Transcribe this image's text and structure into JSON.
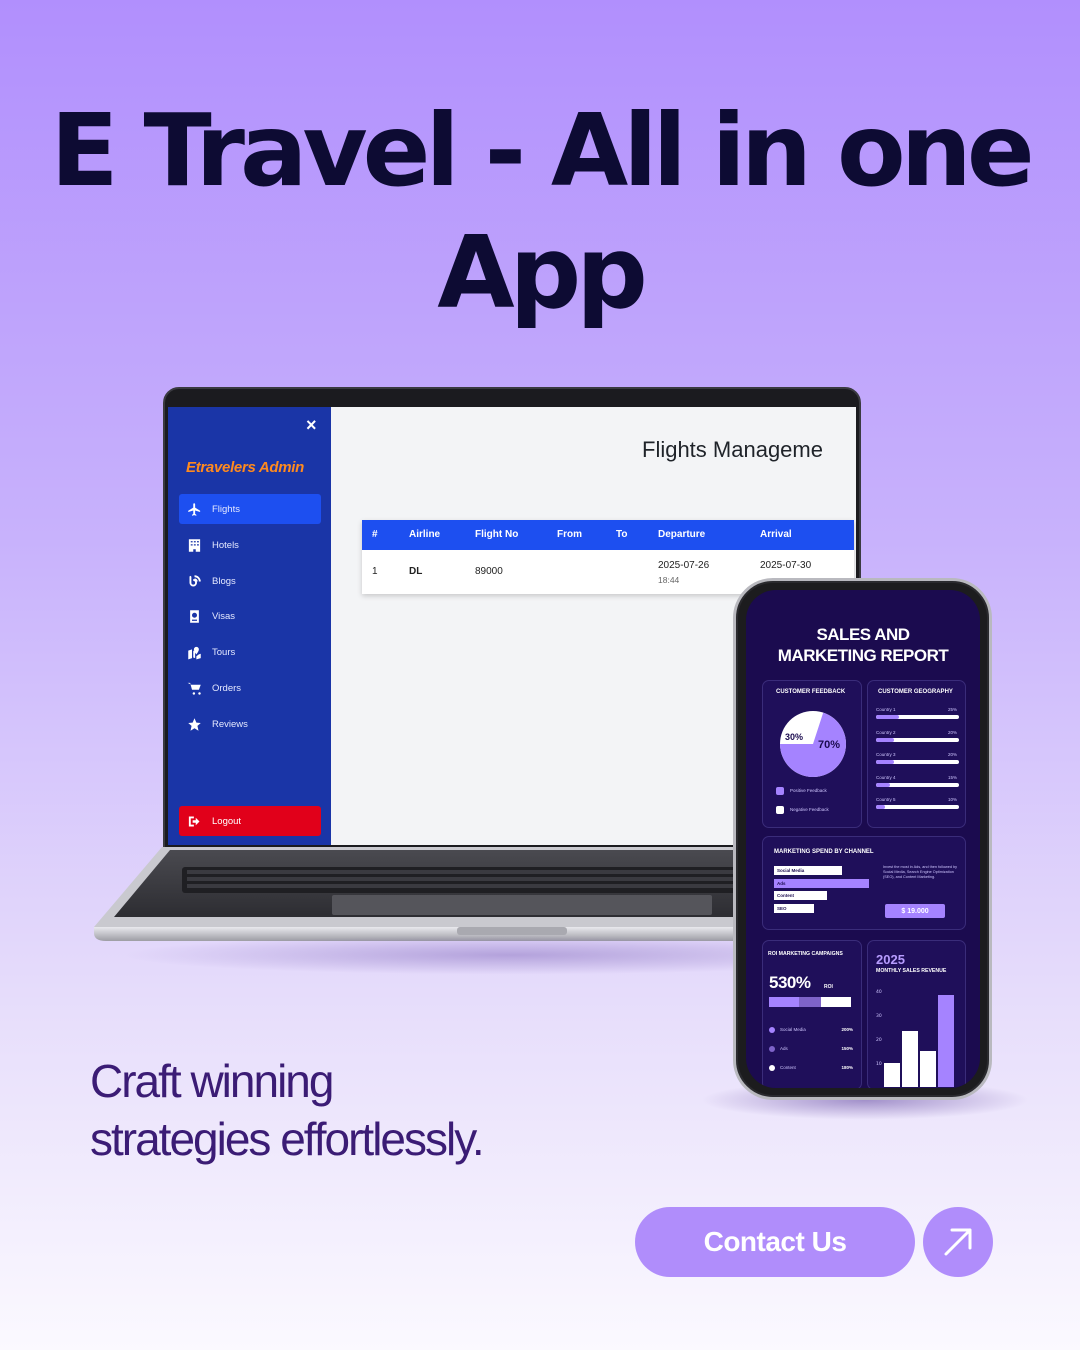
{
  "headline": {
    "line1": "E Travel - All in one",
    "line2": "App"
  },
  "admin": {
    "close_glyph": "×",
    "brand": "Etravelers Admin",
    "nav": [
      {
        "label": "Flights",
        "icon": "plane-icon",
        "active": true
      },
      {
        "label": "Hotels",
        "icon": "hotel-icon",
        "active": false
      },
      {
        "label": "Blogs",
        "icon": "blog-icon",
        "active": false
      },
      {
        "label": "Visas",
        "icon": "passport-icon",
        "active": false
      },
      {
        "label": "Tours",
        "icon": "map-icon",
        "active": false
      },
      {
        "label": "Orders",
        "icon": "cart-icon",
        "active": false
      },
      {
        "label": "Reviews",
        "icon": "star-icon",
        "active": false
      }
    ],
    "logout": "Logout",
    "page_title": "Flights Manageme",
    "table": {
      "headers": [
        "#",
        "Airline",
        "Flight No",
        "From",
        "To",
        "Departure",
        "Arrival"
      ],
      "rows": [
        {
          "num": "1",
          "airline": "DL",
          "flight_no": "89000",
          "from": "",
          "to": "",
          "departure_date": "2025-07-26",
          "departure_time": "18:44",
          "arrival_date": "2025-07-30"
        }
      ]
    },
    "colors": {
      "sidebar": "#1a35a7",
      "active": "#1d4ff0",
      "logout": "#e1001a",
      "brand": "#ff8a1e"
    }
  },
  "report": {
    "title_line1": "SALES AND",
    "title_line2": "MARKETING REPORT",
    "feedback": {
      "title": "CUSTOMER FEEDBACK",
      "negative_pct": "30%",
      "positive_pct": "70%",
      "positive_value": 70,
      "legend": [
        "Positive Feedback",
        "Negative Feedback"
      ]
    },
    "geography": {
      "title": "CUSTOMER GEOGRAPHY",
      "rows": [
        {
          "label": "Country 1",
          "pct": "25%",
          "value": 25
        },
        {
          "label": "Country 2",
          "pct": "20%",
          "value": 20
        },
        {
          "label": "Country 3",
          "pct": "20%",
          "value": 20
        },
        {
          "label": "Country 4",
          "pct": "15%",
          "value": 15
        },
        {
          "label": "Country 5",
          "pct": "10%",
          "value": 10
        }
      ]
    },
    "spend": {
      "title": "MARKETING SPEND BY CHANNEL",
      "channels": [
        {
          "label": "Social Media",
          "value": 0.65
        },
        {
          "label": "Ads",
          "value": 0.9
        },
        {
          "label": "Content",
          "value": 0.5
        },
        {
          "label": "SEO",
          "value": 0.38
        }
      ],
      "note": "Invest the most in Ads, and then followed by Social Media, Search Engine Optimization (SEO), and Content Marketing.",
      "total": "$ 19.000"
    },
    "roi": {
      "title": "ROI MARKETING CAMPAIGNS",
      "value": "530%",
      "unit": "ROI",
      "rows": [
        {
          "label": "Social Media",
          "value": "200%"
        },
        {
          "label": "Ads",
          "value": "150%"
        },
        {
          "label": "Content",
          "value": "180%"
        }
      ]
    },
    "sales": {
      "year": "2025",
      "subtitle": "MONTHLY SALES REVENUE",
      "ticks": [
        "40",
        "30",
        "20",
        "10"
      ]
    }
  },
  "chart_data": {
    "type": "bar",
    "title": "MONTHLY SALES REVENUE",
    "categories": [
      "",
      "",
      "",
      ""
    ],
    "values": [
      6,
      14,
      9,
      23
    ],
    "ylim": [
      0,
      24
    ]
  },
  "tagline": {
    "line1": "Craft winning",
    "line2": "strategies effortlessly."
  },
  "cta": {
    "label": "Contact Us",
    "arrow_icon": "arrow-up-right-icon"
  },
  "colors": {
    "headline": "#0d0b33",
    "accent": "#b08dfb",
    "tagline": "#3b1c75",
    "report_bg": "#1b0b4f"
  }
}
